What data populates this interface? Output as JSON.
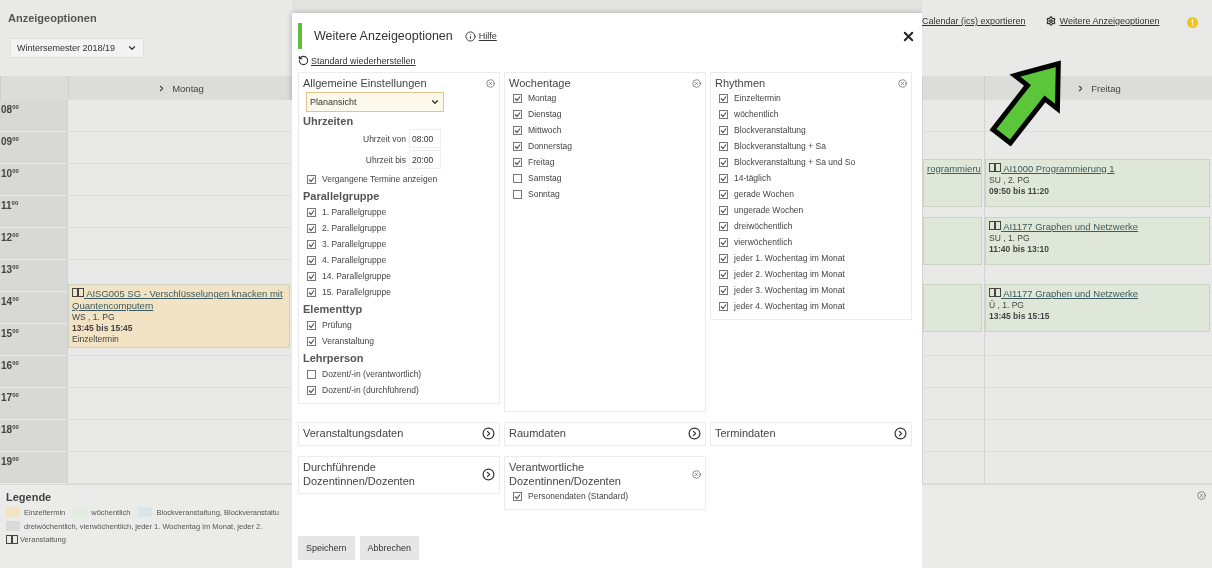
{
  "page": {
    "title": "Anzeigeoptionen",
    "semester": "Wintersemester 2018/19",
    "links": [
      {
        "kind": "plain",
        "label": "Calendar (ics) exportieren"
      },
      {
        "kind": "gear",
        "label": "Weitere Anzeigeoptionen"
      }
    ]
  },
  "calendar": {
    "hours": [
      "08$^{00}$",
      "09$^{00}$",
      "10$^{00}$",
      "11$^{00}$",
      "12$^{00}$",
      "13$^{00}$",
      "14$^{00}$",
      "15$^{00}$",
      "16$^{00}$",
      "17$^{00}$",
      "18$^{00}$",
      "19$^{00}$"
    ],
    "days": [
      {
        "label": "Montag",
        "events": [
          {
            "kind": "full",
            "color": "#f2e3c4",
            "title": "AISG005 SG - Verschlüsselungen knacken mit Quantencomputern",
            "group": "WS , 1. PG",
            "time": "13:45 bis 15:45",
            "rhythm": "Einzeltermin"
          }
        ]
      },
      {
        "events": [
          {
            "kind": "partial",
            "color": "#dfe8d8",
            "title": "rogrammieru"
          },
          {
            "kind": "partial",
            "color": "#dfe8d8"
          },
          {
            "kind": "partial",
            "color": "#dfe8d8"
          }
        ]
      },
      {
        "label": "Freitag",
        "events": [
          {
            "kind": "full",
            "color": "#dfe8d8",
            "title": "AI1000 Programmierung 1",
            "group": "SU , 2. PG",
            "time": "09:50 bis 11:20"
          },
          {
            "kind": "full",
            "color": "#dfe8d8",
            "title": "AI1177 Graphen und Netzwerke",
            "group": "SU , 1. PG",
            "time": "11:40 bis 13:10"
          },
          {
            "kind": "full",
            "color": "#dfe8d8",
            "title": "AI1177 Graphen und Netzwerke",
            "group": "Ü , 1. PG",
            "time": "13:45 bis 15:15"
          }
        ]
      }
    ]
  },
  "legend": {
    "title": "Legende",
    "items": [
      {
        "label": "Einzeltermin",
        "color": "#f2e3c4"
      },
      {
        "label": "wöchentlich",
        "color": "#e3eadf"
      },
      {
        "label": "Blockveranstaltung, Blockveranstaltu",
        "color": "#dbe5ea"
      },
      {
        "label": "dreiwöchentlich, vierwöchentlich, jeder 1. Wochentag im Monat, jeder 2.",
        "color": "#dadada"
      }
    ],
    "event_type": "Veranstaltung"
  },
  "dialog": {
    "title": "Weitere Anzeigeoptionen",
    "help": "Hilfe",
    "reset": "Standard wiederherstellen",
    "panels": [
      {
        "title": "Allgemeine Einstellungen",
        "expanded": true,
        "entries": [
          {
            "kind": "select",
            "value": "Planansicht"
          },
          {
            "kind": "heading",
            "text": "Uhrzeiten"
          },
          {
            "kind": "time",
            "label": "Uhrzeit von",
            "value": "08:00"
          },
          {
            "kind": "time",
            "label": "Uhrzeit bis",
            "value": "20:00"
          },
          {
            "kind": "check",
            "label": "Vergangene Termine anzeigen",
            "checked": true
          },
          {
            "kind": "heading",
            "text": "Parallelgruppe"
          },
          {
            "kind": "check",
            "label": "1. Parallelgruppe",
            "checked": true
          },
          {
            "kind": "check",
            "label": "2. Parallelgruppe",
            "checked": true
          },
          {
            "kind": "check",
            "label": "3. Parallelgruppe",
            "checked": true
          },
          {
            "kind": "check",
            "label": "4. Parallelgruppe",
            "checked": true
          },
          {
            "kind": "check",
            "label": "14. Parallelgruppe",
            "checked": true
          },
          {
            "kind": "check",
            "label": "15. Parallelgruppe",
            "checked": true
          },
          {
            "kind": "heading",
            "text": "Elementtyp"
          },
          {
            "kind": "check",
            "label": "Prüfung",
            "checked": true
          },
          {
            "kind": "check",
            "label": "Veranstaltung",
            "checked": true
          },
          {
            "kind": "heading",
            "text": "Lehrperson"
          },
          {
            "kind": "check",
            "label": "Dozent/-in (verantwortlich)",
            "checked": false
          },
          {
            "kind": "check",
            "label": "Dozent/-in (durchführend)",
            "checked": true
          }
        ]
      },
      {
        "title": "Wochentage",
        "expanded": true,
        "entries": [
          {
            "kind": "check",
            "label": "Montag",
            "checked": true
          },
          {
            "kind": "check",
            "label": "Dienstag",
            "checked": true
          },
          {
            "kind": "check",
            "label": "Mittwoch",
            "checked": true
          },
          {
            "kind": "check",
            "label": "Donnerstag",
            "checked": true
          },
          {
            "kind": "check",
            "label": "Freitag",
            "checked": true
          },
          {
            "kind": "check",
            "label": "Samstag",
            "checked": false
          },
          {
            "kind": "check",
            "label": "Sonntag",
            "checked": false
          }
        ]
      },
      {
        "title": "Rhythmen",
        "expanded": true,
        "entries": [
          {
            "kind": "check",
            "label": "Einzeltermin",
            "checked": true
          },
          {
            "kind": "check",
            "label": "wöchentlich",
            "checked": true
          },
          {
            "kind": "check",
            "label": "Blockveranstaltung",
            "checked": true
          },
          {
            "kind": "check",
            "label": "Blockveranstaltung + Sa",
            "checked": true
          },
          {
            "kind": "check",
            "label": "Blockveranstaltung + Sa und So",
            "checked": true
          },
          {
            "kind": "check",
            "label": "14-täglich",
            "checked": true
          },
          {
            "kind": "check",
            "label": "gerade Wochen",
            "checked": true
          },
          {
            "kind": "check",
            "label": "ungerade Wochen",
            "checked": true
          },
          {
            "kind": "check",
            "label": "dreiwöchentlich",
            "checked": true
          },
          {
            "kind": "check",
            "label": "vierwöchentlich",
            "checked": true
          },
          {
            "kind": "check",
            "label": "jeder 1. Wochentag im Monat",
            "checked": true
          },
          {
            "kind": "check",
            "label": "jeder 2. Wochentag im Monat",
            "checked": true
          },
          {
            "kind": "check",
            "label": "jeder 3. Wochentag im Monat",
            "checked": true
          },
          {
            "kind": "check",
            "label": "jeder 4. Wochentag im Monat",
            "checked": true
          }
        ]
      },
      {
        "title": "Veranstaltungsdaten",
        "expanded": false
      },
      {
        "title": "Raumdaten",
        "expanded": false
      },
      {
        "title": "Termindaten",
        "expanded": false
      },
      {
        "title": "Durchführende Dozentinnen/Dozenten",
        "expanded": false
      },
      {
        "title": "Verantwortliche Dozentinnen/Dozenten",
        "expanded": true,
        "entries": [
          {
            "kind": "check",
            "label": "Personendaten (Standard)",
            "checked": true
          }
        ]
      }
    ],
    "buttons": [
      "Speichern",
      "Abbrechen"
    ]
  }
}
